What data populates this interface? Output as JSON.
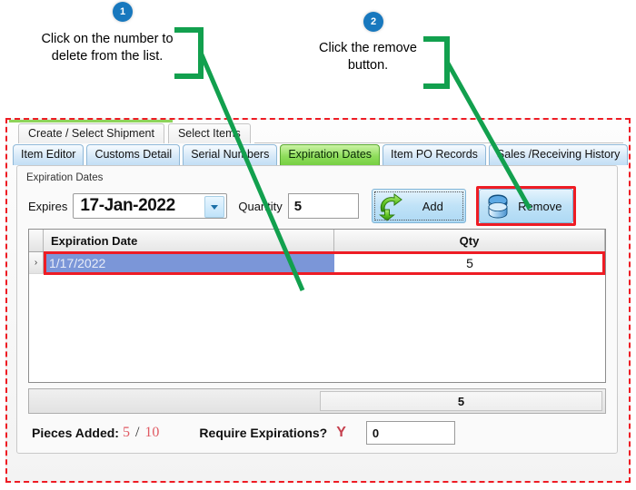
{
  "annotations": {
    "badges": [
      {
        "number": "1"
      },
      {
        "number": "2"
      }
    ],
    "callouts": [
      {
        "text": "Click on the number to delete from the list."
      },
      {
        "text": "Click the remove button."
      }
    ],
    "leader_color": "#12a04e",
    "badge_color": "#1878be",
    "highlight_color": "#ee1c24"
  },
  "window": {
    "outer_tabs": [
      {
        "label": "Create / Select Shipment",
        "active": false
      },
      {
        "label": "Select Items",
        "active": false
      }
    ],
    "inner_tabs": [
      {
        "label": "Item Editor",
        "active": false
      },
      {
        "label": "Customs Detail",
        "active": false
      },
      {
        "label": "Serial Numbers",
        "active": false
      },
      {
        "label": "Expiration Dates",
        "active": true
      },
      {
        "label": "Item PO Records",
        "active": false
      },
      {
        "label": "Sales /Receiving History",
        "active": false
      }
    ],
    "active_tab_color": "#8fdd5c"
  },
  "group": {
    "title": "Expiration Dates",
    "expires_label": "Expires",
    "expires_value": "17-Jan-2022",
    "quantity_label": "Quantity",
    "quantity_value": "5",
    "add_button": "Add",
    "remove_button": "Remove",
    "add_icon": "green-curved-arrow-icon",
    "remove_icon": "blue-database-icon"
  },
  "grid": {
    "columns": [
      "Expiration Date",
      "Qty"
    ],
    "row_indicator": "›",
    "rows": [
      {
        "date": "1/17/2022",
        "qty": "5",
        "selected": true
      }
    ],
    "selection_color": "#7b96d8",
    "total": "5"
  },
  "footer": {
    "pieces_label": "Pieces Added:",
    "pieces_added": "5",
    "separator": "/",
    "pieces_total": "10",
    "require_label": "Require Expirations?",
    "require_value": "Y",
    "extra_value": "0"
  }
}
